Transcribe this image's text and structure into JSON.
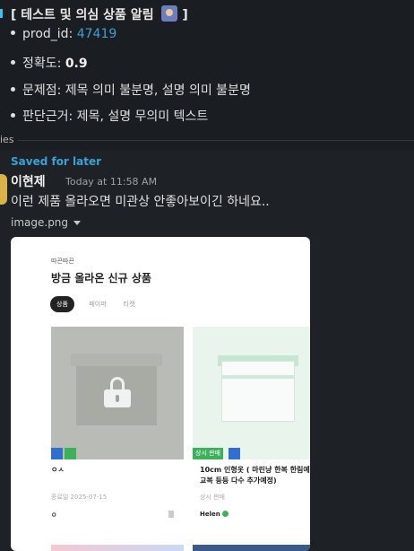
{
  "alert": {
    "title": "[ 테스트 및 의심 상품 알림",
    "title_end": "]",
    "title_emoji": "police-officer-icon",
    "items": [
      {
        "label": "prod_id: ",
        "value": "47419"
      },
      {
        "label": "정확도: ",
        "value": "0.9"
      },
      {
        "label": "문제점: 제목 의미 불분명, 설명 의미 불분명"
      },
      {
        "label": "판단근거: 제목, 설명 무의미 텍스트"
      }
    ]
  },
  "thread": {
    "replies_text": "ies"
  },
  "saved": {
    "label": "Saved for later",
    "author": "이현제",
    "timestamp": "Today at 11:58 AM",
    "message": "이런 제품 올라오면 미관상 안좋아보이긴 하네요..",
    "file_name": "image.png"
  },
  "preview": {
    "small_label": "따끈따끈",
    "heading": "방금 올라온 신규 상품",
    "tabs": [
      "상품",
      "페이퍼",
      "티켓"
    ],
    "products": [
      {
        "title": "ㅇㅅ",
        "meta": "종료일 2025-07-15",
        "seller": "ㅇ"
      },
      {
        "badge": "상시 판매",
        "title_line1": "10cm 인형옷 ( 마린냥 한복 한림예",
        "title_line2": "교복 등등 다수 추가예정)",
        "meta": "상시 판매",
        "seller": "Helen"
      }
    ]
  },
  "colors": {
    "accent_link": "#3f9fd6",
    "saved_label": "#36a3d8",
    "badge_blue": "#2f6fd1",
    "badge_green": "#3bb15a"
  }
}
